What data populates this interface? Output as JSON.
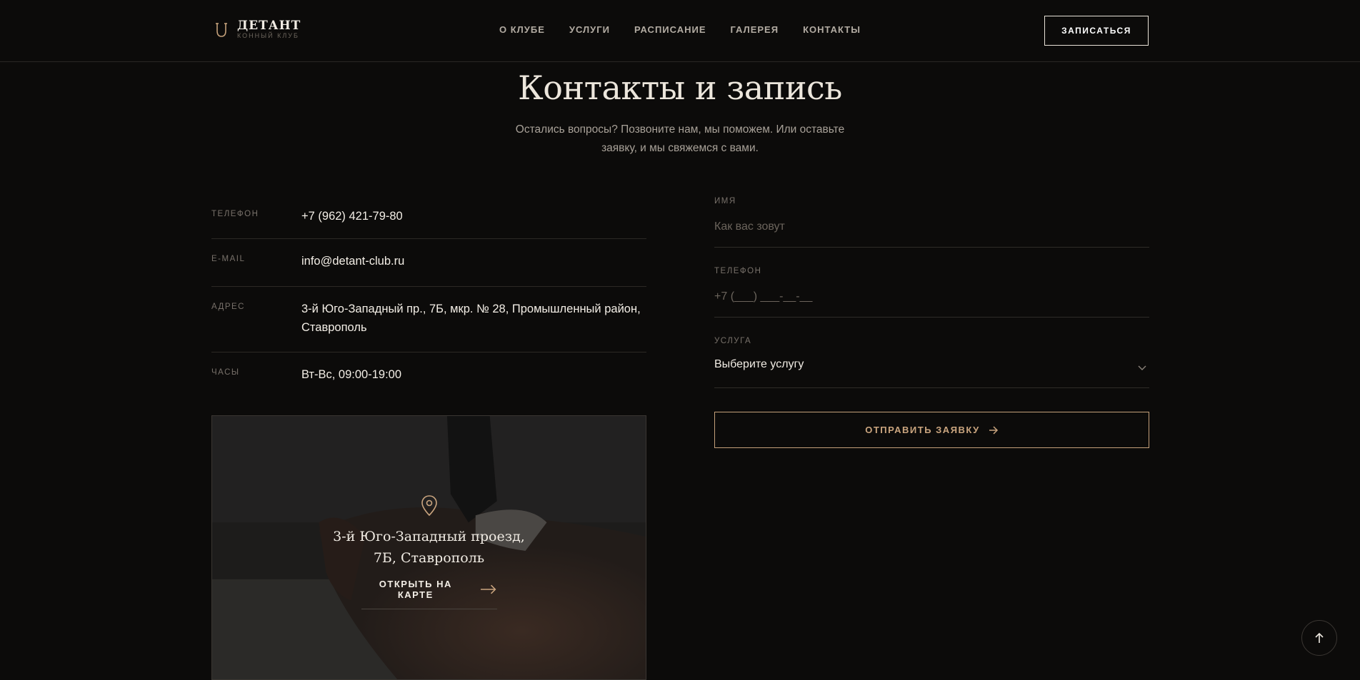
{
  "header": {
    "logo_title": "ДЕТАНТ",
    "logo_subtitle": "КОННЫЙ КЛУБ",
    "nav": [
      "О КЛУБЕ",
      "УСЛУГИ",
      "РАСПИСАНИЕ",
      "ГАЛЕРЕЯ",
      "КОНТАКТЫ"
    ],
    "cta_label": "ЗАПИСАТЬСЯ"
  },
  "section": {
    "title": "Контакты и запись",
    "subtitle": "Остались вопросы? Позвоните нам, мы поможем. Или оставьте заявку, и мы свяжемся с вами."
  },
  "contacts": [
    {
      "label": "ТЕЛЕФОН",
      "value": "+7 (962) 421-79-80"
    },
    {
      "label": "E-MAIL",
      "value": "info@detant-club.ru"
    },
    {
      "label": "АДРЕС",
      "value": "3-й Юго-Западный пр., 7Б, мкр. № 28, Промышленный район, Ставрополь"
    },
    {
      "label": "ЧАСЫ",
      "value": "Вт-Вс, 09:00-19:00"
    }
  ],
  "map_card": {
    "icon": "map-pin-icon",
    "address": "3-й Юго-Западный проезд, 7Б, Ставрополь",
    "link_label": "ОТКРЫТЬ НА КАРТЕ"
  },
  "form": {
    "name_label": "ИМЯ",
    "name_placeholder": "Как вас зовут",
    "phone_label": "ТЕЛЕФОН",
    "phone_placeholder": "+7 (___) ___-__-__",
    "service_label": "УСЛУГА",
    "service_selected": "Выберите услугу",
    "submit_label": "ОТПРАВИТЬ ЗАЯВКУ"
  },
  "colors": {
    "background": "#0c0b0a",
    "accent": "#caa57f",
    "text": "#e9e4dc"
  }
}
